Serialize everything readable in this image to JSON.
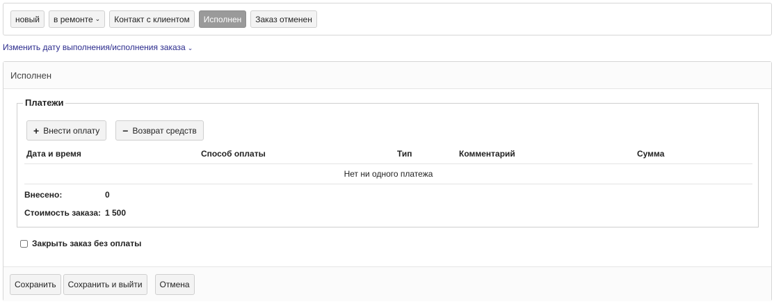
{
  "status_bar": {
    "buttons": [
      {
        "label": "новый",
        "active": false,
        "has_caret": false
      },
      {
        "label": "в ремонте",
        "active": false,
        "has_caret": true
      },
      {
        "label": "Контакт с клиентом",
        "active": false,
        "has_caret": false
      },
      {
        "label": "Исполнен",
        "active": true,
        "has_caret": false
      },
      {
        "label": "Заказ отменен",
        "active": false,
        "has_caret": false
      }
    ]
  },
  "change_date_link": "Изменить дату выполнения/исполнения заказа",
  "panel": {
    "title": "Исполнен",
    "payments": {
      "legend": "Платежи",
      "add_payment_label": "Внести оплату",
      "refund_label": "Возврат средств",
      "columns": [
        "Дата и время",
        "Способ оплаты",
        "Тип",
        "Комментарий",
        "Сумма"
      ],
      "empty_text": "Нет ни одного платежа",
      "paid_label": "Внесено:",
      "paid_value": "0",
      "cost_label": "Стоимость заказа:",
      "cost_value": "1 500"
    },
    "close_without_payment": {
      "label": "Закрыть заказ без оплаты",
      "checked": false
    }
  },
  "footer": {
    "save_label": "Сохранить",
    "save_exit_label": "Сохранить и выйти",
    "cancel_label": "Отмена"
  },
  "colors": {
    "active_button": "#9a9a9a",
    "link": "#2a2a8c",
    "border": "#d6d6d6"
  }
}
